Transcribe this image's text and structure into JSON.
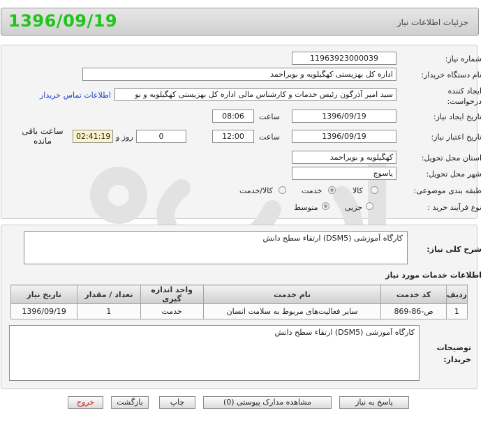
{
  "header": {
    "date": "1396/09/19",
    "title": "جزئیات اطلاعات نیاز"
  },
  "form": {
    "need_number": {
      "label": "شماره نیاز:",
      "value": "1196392300003‌9"
    },
    "buyer_org": {
      "label": "نام دستگاه خریدار:",
      "value": "اداره کل بهزیستی کهگیلویه و بویراحمد"
    },
    "requester": {
      "label": "ایجاد کننده",
      "label2": "درخواست:",
      "value": "سید امیر آذرگون رئیس خدمات و کارشناس مالی اداره کل بهزیستی کهگیلویه و بو",
      "contact_link": "اطلاعات تماس خریدار"
    },
    "created": {
      "label": "تاریخ ایجاد نیاز:",
      "date": "1396/09/19",
      "time_label": "ساعت",
      "time": "08:06"
    },
    "validity": {
      "label": "تاریخ اعتبار نیاز:",
      "date": "1396/09/19",
      "time_label": "ساعت",
      "time": "12:00",
      "days": "0",
      "days_label": "روز و",
      "remaining": "02:41:19",
      "remaining_label": "ساعت باقی مانده"
    },
    "province": {
      "label": "استان محل تحویل:",
      "value": "کهگیلویه و بویراحمد"
    },
    "city": {
      "label": "شهر محل تحویل:",
      "value": "یاسوج"
    },
    "category": {
      "label": "طبقه بندی موضوعی:",
      "options": [
        "کالا",
        "خدمت",
        "کالا/خدمت"
      ],
      "selected": "خدمت"
    },
    "purchase_type": {
      "label": "نوع فرآیند خرید :",
      "options": [
        "جزیی",
        "متوسط"
      ],
      "selected": "متوسط"
    }
  },
  "summary": {
    "label": "شرح کلی نیاز:",
    "value": "کارگاه آموزشی   (DSM5)   ارتقاء سطح دانش"
  },
  "services": {
    "title": "اطلاعات خدمات مورد نیاز",
    "columns": [
      "ردیف",
      "کد خدمت",
      "نام خدمت",
      "واحد اندازه گیری",
      "تعداد / مقدار",
      "تاریخ نیاز"
    ],
    "rows": [
      [
        "1",
        "ص-86-869",
        "سایر فعالیت‌های مربوط به سلامت انسان",
        "خدمت",
        "1",
        "1396/09/19"
      ]
    ]
  },
  "notes": {
    "label": "توضیحات",
    "label2": "خریدار:",
    "value": "کارگاه آموزشی   (DSM5)   ارتقاء سطح دانش"
  },
  "buttons": {
    "reply": "پاسخ به نیاز",
    "attachments": "مشاهده مدارک پیوستی (0)",
    "print": "چاپ",
    "back": "بازگشت",
    "exit": "خروج"
  },
  "colors": {
    "date": "#22c31d",
    "link": "#1a3fcf",
    "exit": "#dd1111",
    "remaining_bg": "#fdf5c9"
  }
}
